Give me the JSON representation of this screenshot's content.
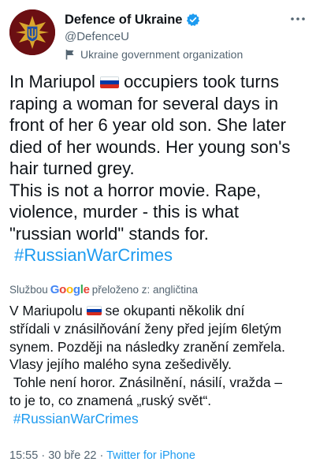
{
  "account": {
    "name": "Defence of Ukraine",
    "handle": "@DefenceU",
    "label": "Ukraine government organization"
  },
  "tweet": {
    "line1_a": "In Mariupol ",
    "line1_b": " occupiers took turns",
    "rest": "raping a woman for several days in\nfront of her 6 year old son. She later\ndied of her wounds. Her young son's\nhair turned grey.\nThis is not a horror movie. Rape,\nviolence, murder - this is what\n\"russian world\" stands for.\n ",
    "hashtag": "#RussianWarCrimes"
  },
  "translation": {
    "prefix": "Službou",
    "google": {
      "letters": [
        "G",
        "o",
        "o",
        "g",
        "l",
        "e"
      ],
      "colors": [
        "#4285f4",
        "#ea4335",
        "#fbbc05",
        "#4285f4",
        "#34a853",
        "#ea4335"
      ]
    },
    "suffix": "přeloženo z: angličtina",
    "line1_a": "V Mariupolu ",
    "line1_b": " se okupanti několik dní",
    "rest": "střídali v znásilňování ženy před jejím 6letým\nsynem. Později na následky zranění zemřela.\nVlasy jejího malého syna zešedivěly.\n Tohle není horor. Znásilnění, násilí, vražda –\nto je to, co znamená „ruský svět“.\n ",
    "hashtag": "#RussianWarCrimes"
  },
  "meta": {
    "time": "15:55",
    "sep1": " · ",
    "date": "30 bře 22",
    "sep2": " · ",
    "source": "Twitter for iPhone"
  },
  "colors": {
    "accent": "#1d9bf0",
    "secondary_text": "#536471",
    "avatar_bg": "#6b0f13",
    "flag_white": "#ffffff",
    "flag_blue": "#0039a6",
    "flag_red": "#d52b1e"
  },
  "icons": {
    "avatar": "ukraine-mod-emblem",
    "verified": "verified-badge-icon",
    "org": "flag-icon",
    "more": "more-icon",
    "flag_emoji": "russia-flag-emoji"
  }
}
